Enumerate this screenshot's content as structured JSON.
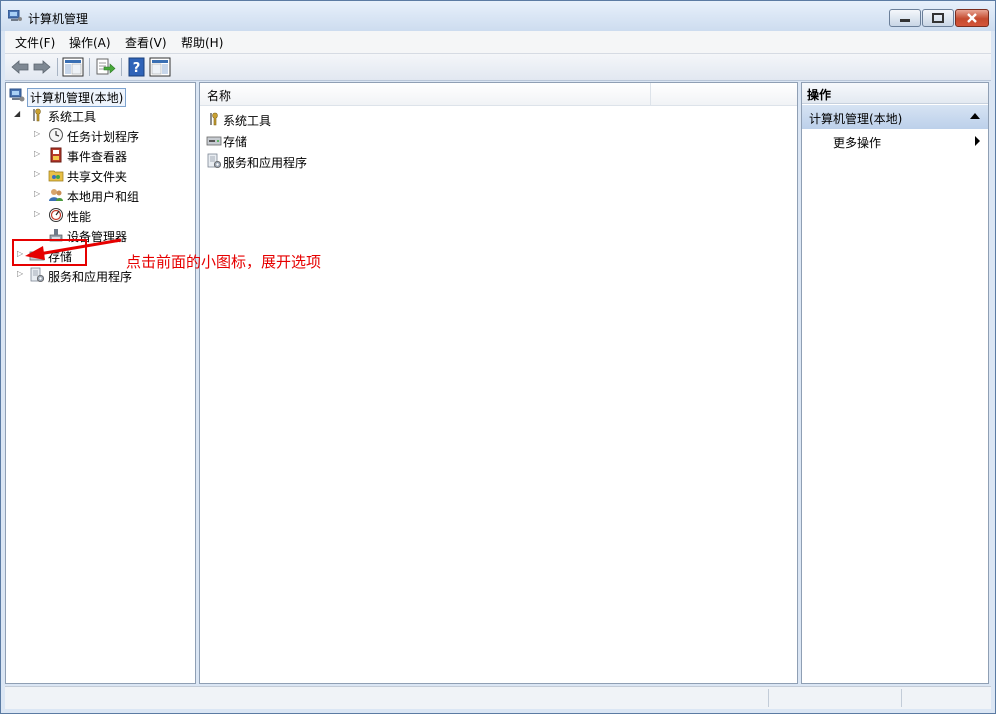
{
  "window": {
    "title": "计算机管理"
  },
  "menu": [
    "文件(F)",
    "操作(A)",
    "查看(V)",
    "帮助(H)"
  ],
  "toolbar": {
    "buttons": [
      "back-icon",
      "forward-icon",
      "show-hide-console-tree-icon",
      "export-list-icon",
      "help-icon",
      "show-hide-action-pane-icon"
    ]
  },
  "tree": {
    "root": "计算机管理(本地)",
    "system_tools": "系统工具",
    "system_children": [
      "任务计划程序",
      "事件查看器",
      "共享文件夹",
      "本地用户和组",
      "性能",
      "设备管理器"
    ],
    "storage": "存储",
    "services": "服务和应用程序"
  },
  "center": {
    "column_name": "名称",
    "items": [
      "系统工具",
      "存储",
      "服务和应用程序"
    ]
  },
  "actions": {
    "header": "操作",
    "section": "计算机管理(本地)",
    "more": "更多操作"
  },
  "annotation": {
    "text": "点击前面的小图标，展开选项",
    "color": "#e60000"
  },
  "colors": {
    "accent": "#bcd0ea",
    "annotation": "#e60000"
  }
}
